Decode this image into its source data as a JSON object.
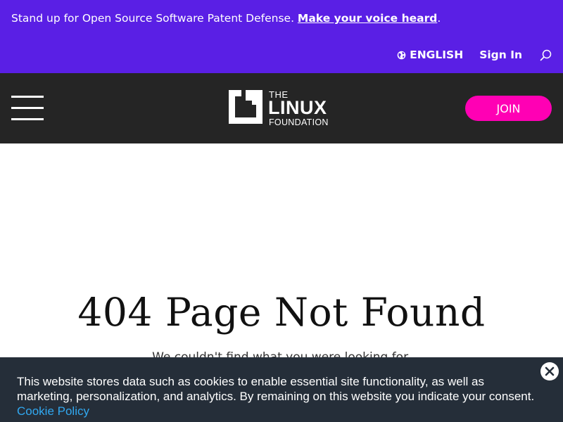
{
  "announcement": {
    "text": "Stand up for Open Source Software Patent Defense. ",
    "cta": "Make your voice heard",
    "trailing": "."
  },
  "utility": {
    "language": "ENGLISH",
    "language_icon": "globe-icon",
    "signin": "Sign In",
    "search_icon": "search-icon"
  },
  "header": {
    "menu_icon": "hamburger-menu-icon",
    "logo": {
      "the": "THE",
      "linux": "LINUX",
      "foundation": "FOUNDATION"
    },
    "join_label": "JOIN"
  },
  "main": {
    "title": "404 Page Not Found",
    "subtitle": "We couldn't find what you were looking for."
  },
  "cookie_banner": {
    "text": "This website stores data such as cookies to enable essential site functionality, as well as marketing, personalization, and analytics. By remaining on this website you indicate your consent. ",
    "link": "Cookie Policy",
    "close_icon": "close-icon"
  },
  "colors": {
    "topbar": "#5a1fe5",
    "header": "#252525",
    "join_button": "#ff00b4",
    "cookie_banner": "#252e39",
    "cookie_link": "#31a8f0"
  }
}
